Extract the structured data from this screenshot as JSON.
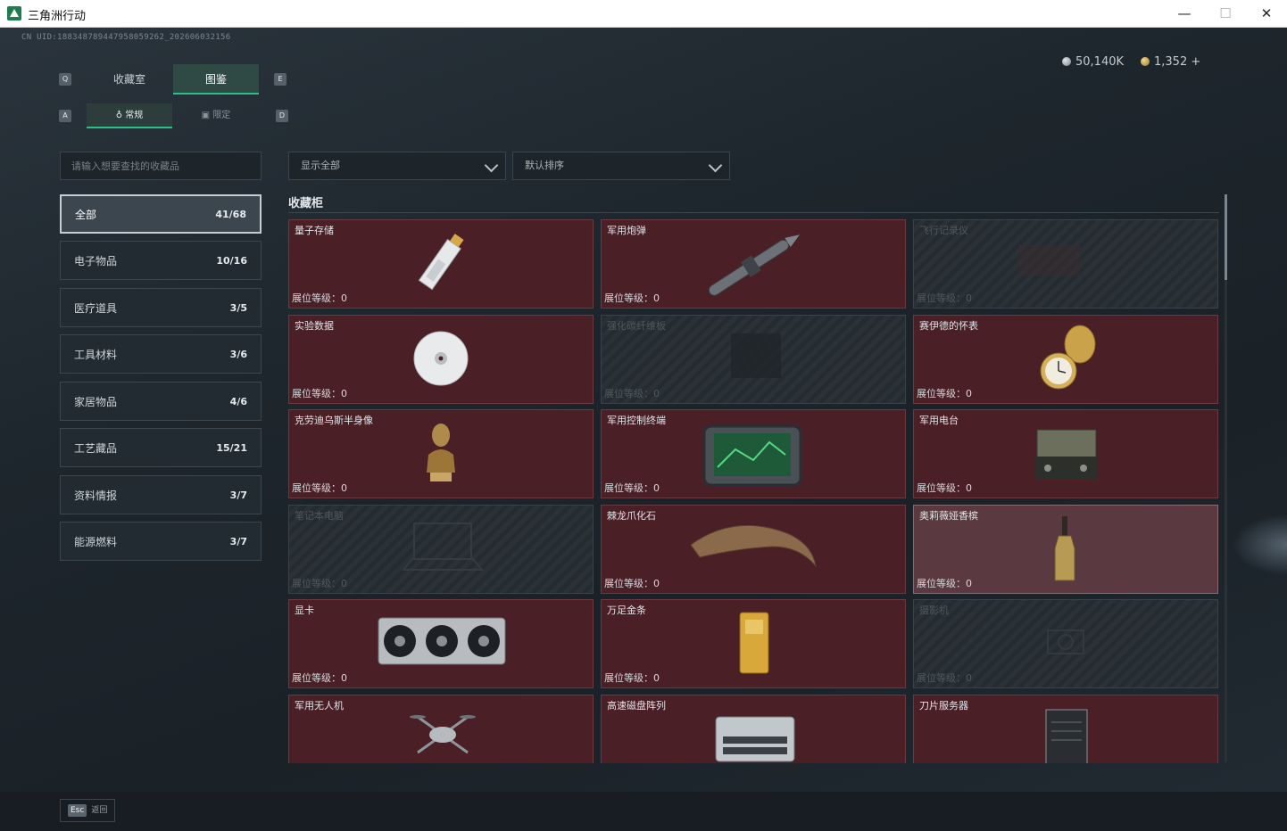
{
  "window": {
    "title": "三角洲行动"
  },
  "header": {
    "uid": "CN UID:1883487894479580592​62_202606032156",
    "currency_silver": "50,140K",
    "currency_gold": "1,352 +"
  },
  "tabs": {
    "key_left": "Q",
    "key_right": "E",
    "items": [
      {
        "label": "收藏室"
      },
      {
        "label": "图鉴"
      }
    ]
  },
  "subtabs": {
    "key_left": "A",
    "key_right": "D",
    "items": [
      {
        "label": "常规"
      },
      {
        "label": "限定"
      }
    ]
  },
  "search": {
    "placeholder": "请输入想要查找的收藏品"
  },
  "categories": [
    {
      "label": "全部",
      "count": "41/68"
    },
    {
      "label": "电子物品",
      "count": "10/16"
    },
    {
      "label": "医疗道具",
      "count": "3/5"
    },
    {
      "label": "工具材料",
      "count": "3/6"
    },
    {
      "label": "家居物品",
      "count": "4/6"
    },
    {
      "label": "工艺藏品",
      "count": "15/21"
    },
    {
      "label": "资料情报",
      "count": "3/7"
    },
    {
      "label": "能源燃料",
      "count": "3/7"
    }
  ],
  "filters": {
    "filter_label": "显示全部",
    "sort_label": "默认排序"
  },
  "section": {
    "title": "收藏柜"
  },
  "level_label": "展位等级：",
  "items": [
    {
      "name": "量子存储",
      "level": "0"
    },
    {
      "name": "军用炮弹",
      "level": "0"
    },
    {
      "name": "飞行记录仪",
      "level": "0"
    },
    {
      "name": "实验数据",
      "level": "0"
    },
    {
      "name": "强化碳纤维板",
      "level": "0"
    },
    {
      "name": "赛伊德的怀表",
      "level": "0"
    },
    {
      "name": "克劳迪乌斯半身像",
      "level": "0"
    },
    {
      "name": "军用控制终端",
      "level": "0"
    },
    {
      "name": "军用电台",
      "level": "0"
    },
    {
      "name": "笔记本电脑",
      "level": "0"
    },
    {
      "name": "棘龙爪化石",
      "level": "0"
    },
    {
      "name": "奥莉薇娅香槟",
      "level": "0"
    },
    {
      "name": "显卡",
      "level": "0"
    },
    {
      "name": "万足金条",
      "level": "0"
    },
    {
      "name": "摄影机",
      "level": "0"
    },
    {
      "name": "军用无人机",
      "level": ""
    },
    {
      "name": "高速磁盘阵列",
      "level": ""
    },
    {
      "name": "刀片服务器",
      "level": ""
    }
  ],
  "footer": {
    "esc_key": "Esc",
    "esc_label": "返回"
  }
}
